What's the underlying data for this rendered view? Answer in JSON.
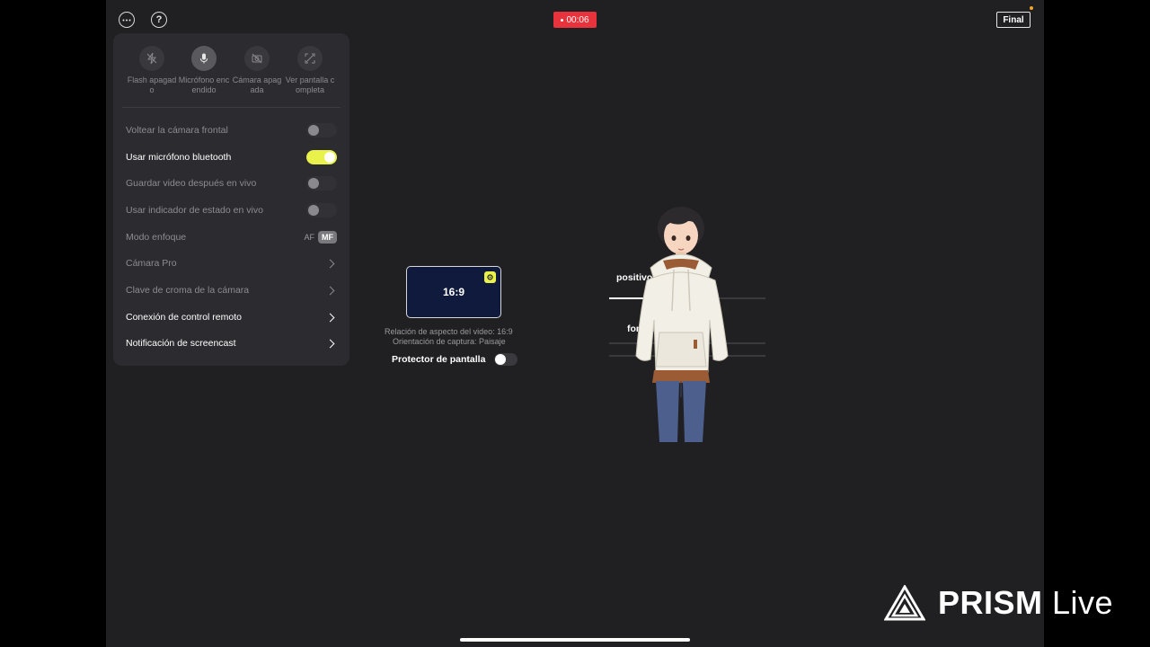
{
  "topbar": {
    "more_icon": "ellipsis-icon",
    "help_icon": "question-icon",
    "help_glyph": "?",
    "recording_time": "00:06",
    "final_label": "Final"
  },
  "quick_actions": [
    {
      "label": "Flash apagado",
      "icon": "flash-off-icon",
      "active": false
    },
    {
      "label": "Micrófono encendido",
      "icon": "microphone-icon",
      "active": true
    },
    {
      "label": "Cámara apagada",
      "icon": "camera-off-icon",
      "active": false
    },
    {
      "label": "Ver pantalla completa",
      "icon": "fullscreen-icon",
      "active": false
    }
  ],
  "settings": {
    "flip_front": {
      "label": "Voltear la cámara frontal",
      "on": false
    },
    "bt_mic": {
      "label": "Usar micrófono bluetooth",
      "on": true
    },
    "save_video": {
      "label": "Guardar video después en vivo",
      "on": false
    },
    "status_indicator": {
      "label": "Usar indicador de estado en vivo",
      "on": false
    },
    "focus": {
      "label": "Modo enfoque",
      "opt_af": "AF",
      "opt_mf": "MF",
      "selected": "MF"
    },
    "camera_pro": {
      "label": "Cámara Pro"
    },
    "chroma_key": {
      "label": "Clave de croma de la cámara"
    },
    "remote": {
      "label": "Conexión de control remoto"
    },
    "screencast": {
      "label": "Notificación de screencast"
    }
  },
  "aspect": {
    "ratio": "16:9",
    "caption_ratio": "Relación de aspecto del video: 16:9",
    "caption_orientation": "Orientación de captura: Paisaje",
    "protector_label": "Protector de pantalla"
  },
  "partial": {
    "device": "positivo",
    "mic": "fono",
    "help_glyph": "?"
  },
  "watermark": {
    "brand": "PRISM",
    "suffix": " Live"
  },
  "colors": {
    "accent": "#e9f24a",
    "recording": "#e8323c",
    "panel": "#2c2b2f",
    "background": "#201f22"
  }
}
